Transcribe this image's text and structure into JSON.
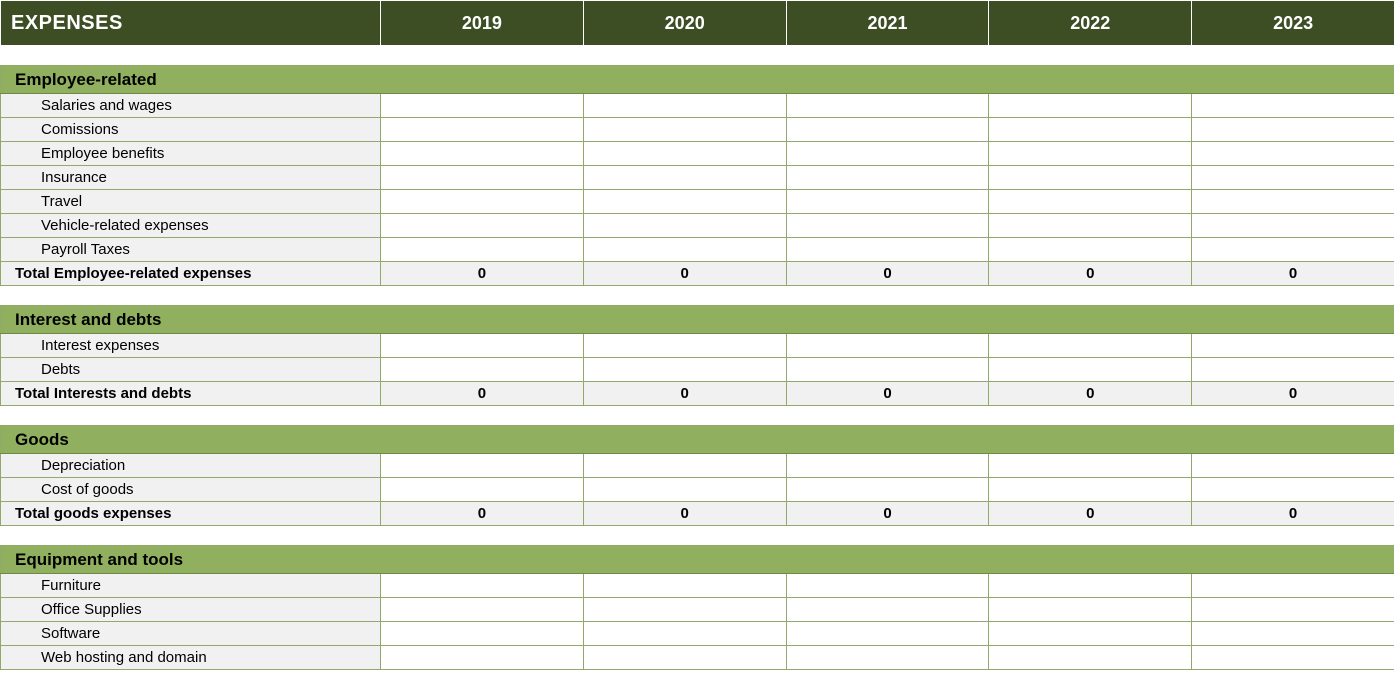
{
  "header": {
    "title": "EXPENSES",
    "years": [
      "2019",
      "2020",
      "2021",
      "2022",
      "2023"
    ]
  },
  "sections": [
    {
      "name": "Employee-related",
      "items": [
        "Salaries and wages",
        "Comissions",
        "Employee benefits",
        "Insurance",
        "Travel",
        "Vehicle-related expenses",
        "Payroll Taxes"
      ],
      "total_label": "Total Employee-related expenses",
      "totals": [
        "0",
        "0",
        "0",
        "0",
        "0"
      ]
    },
    {
      "name": "Interest and debts",
      "items": [
        "Interest expenses",
        "Debts"
      ],
      "total_label": "Total Interests and debts",
      "totals": [
        "0",
        "0",
        "0",
        "0",
        "0"
      ]
    },
    {
      "name": "Goods",
      "items": [
        "Depreciation",
        "Cost of goods"
      ],
      "total_label": "Total goods expenses",
      "totals": [
        "0",
        "0",
        "0",
        "0",
        "0"
      ]
    },
    {
      "name": "Equipment and tools",
      "items": [
        "Furniture",
        "Office Supplies",
        "Software",
        "Web hosting and domain"
      ],
      "total_label": "",
      "totals": []
    }
  ]
}
